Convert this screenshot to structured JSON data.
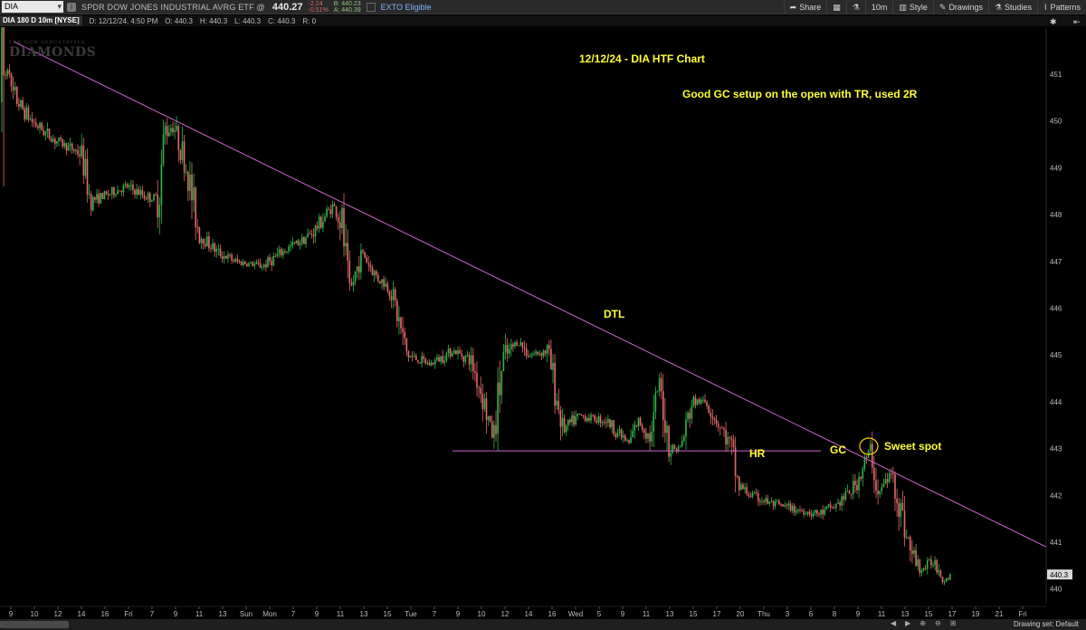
{
  "toolbar": {
    "symbol": "DIA",
    "ticker_name": "SPDR DOW JONES INDUSTRIAL AVRG ETF @",
    "last_price": "440.27",
    "change": "-2.24",
    "change_pct": "-0.51%",
    "bid": "B: 440.23",
    "ask": "A: 440.39",
    "exto": "EXTO Eligible",
    "share_label": "Share",
    "interval_label": "10m",
    "style_label": "Style",
    "drawings_label": "Drawings",
    "studies_label": "Studies",
    "patterns_label": "Patterns"
  },
  "infobar": {
    "chart_id": "DIA 180 D 10m [NYSE]",
    "date": "D: 12/12/24, 4:50 PM",
    "open": "O: 440.3",
    "high": "H: 440.3",
    "low": "L: 440.3",
    "close": "C: 440.3",
    "range": "R: 0"
  },
  "watermark": {
    "top": "THE DOW INDUSTRIALS",
    "main": "DIAMONDS"
  },
  "annotations": {
    "title": "12/12/24 - DIA HTF Chart",
    "note": "Good GC setup on the open with TR, used 2R",
    "dtl": "DTL",
    "hr": "HR",
    "gc": "GC",
    "sweet": "Sweet spot"
  },
  "status": {
    "drawing_set": "Drawing set: Default"
  },
  "colors": {
    "up": "#2fb84a",
    "down": "#e66a6a",
    "trendline": "#cc66cc",
    "annotation": "#ffff33",
    "marker": "#ffd700"
  },
  "chart_data": {
    "type": "candlestick",
    "symbol": "DIA",
    "interval": "10m",
    "ylim": [
      439.7,
      451.9
    ],
    "y_ticks": [
      "451",
      "450",
      "449",
      "448",
      "447",
      "446",
      "445",
      "444",
      "443",
      "442",
      "441",
      "440"
    ],
    "x_ticks": [
      "9",
      "10",
      "12",
      "14",
      "16",
      "Fri",
      "7",
      "9",
      "11",
      "13",
      "Sun",
      "Mon",
      "7",
      "9",
      "11",
      "13",
      "15",
      "Tue",
      "7",
      "9",
      "10",
      "12",
      "14",
      "16",
      "Wed",
      "5",
      "9",
      "11",
      "13",
      "15",
      "17",
      "20",
      "Thu",
      "3",
      "6",
      "8",
      "9",
      "11",
      "13",
      "15",
      "17",
      "19",
      "21",
      "Fri"
    ],
    "current_price_label": "440.3",
    "path_keypoints": [
      [
        0,
        450.4
      ],
      [
        10,
        451.3
      ],
      [
        12,
        450.6
      ],
      [
        35,
        450.0
      ],
      [
        60,
        449.6
      ],
      [
        90,
        449.3
      ],
      [
        100,
        448.3
      ],
      [
        115,
        448.4
      ],
      [
        140,
        448.6
      ],
      [
        160,
        448.4
      ],
      [
        175,
        448.3
      ],
      [
        182,
        449.8
      ],
      [
        192,
        449.9
      ],
      [
        205,
        449.1
      ],
      [
        220,
        447.6
      ],
      [
        240,
        447.2
      ],
      [
        260,
        447.0
      ],
      [
        290,
        446.9
      ],
      [
        320,
        447.3
      ],
      [
        345,
        447.6
      ],
      [
        368,
        448.2
      ],
      [
        378,
        447.8
      ],
      [
        386,
        446.3
      ],
      [
        400,
        447.2
      ],
      [
        415,
        446.7
      ],
      [
        432,
        446.4
      ],
      [
        450,
        445.0
      ],
      [
        475,
        444.8
      ],
      [
        500,
        445.1
      ],
      [
        520,
        444.9
      ],
      [
        532,
        444.2
      ],
      [
        545,
        443.2
      ],
      [
        556,
        444.9
      ],
      [
        572,
        445.3
      ],
      [
        585,
        445.0
      ],
      [
        605,
        445.1
      ],
      [
        622,
        443.4
      ],
      [
        640,
        443.7
      ],
      [
        670,
        443.6
      ],
      [
        695,
        443.1
      ],
      [
        705,
        443.6
      ],
      [
        720,
        443.2
      ],
      [
        728,
        444.5
      ],
      [
        740,
        443.0
      ],
      [
        752,
        443.0
      ],
      [
        765,
        444.0
      ],
      [
        780,
        444.0
      ],
      [
        795,
        443.5
      ],
      [
        808,
        443.0
      ],
      [
        816,
        442.2
      ],
      [
        830,
        442.0
      ],
      [
        855,
        441.8
      ],
      [
        880,
        441.7
      ],
      [
        905,
        441.6
      ],
      [
        925,
        441.8
      ],
      [
        945,
        442.2
      ],
      [
        962,
        443.0
      ],
      [
        970,
        442.0
      ],
      [
        985,
        442.5
      ],
      [
        995,
        441.7
      ],
      [
        1006,
        440.8
      ],
      [
        1018,
        440.4
      ],
      [
        1032,
        440.6
      ],
      [
        1044,
        440.2
      ],
      [
        1050,
        440.3
      ]
    ],
    "trendlines": [
      {
        "name": "DTL",
        "points": [
          [
            15,
            451.7
          ],
          [
            1156,
            440.9
          ]
        ]
      },
      {
        "name": "HR",
        "points": [
          [
            500,
            442.95
          ],
          [
            907,
            442.95
          ]
        ]
      }
    ]
  }
}
